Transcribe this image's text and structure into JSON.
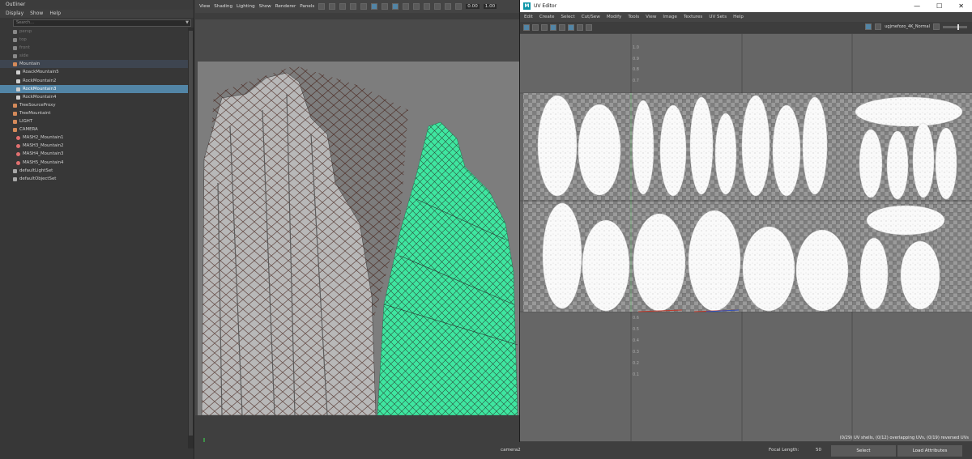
{
  "outliner": {
    "title": "Outliner",
    "menu": [
      "Display",
      "Show",
      "Help"
    ],
    "search_placeholder": "Search...",
    "items": [
      {
        "label": "persp",
        "indent": 0,
        "icon": "camera-icon",
        "state": "dim"
      },
      {
        "label": "top",
        "indent": 0,
        "icon": "camera-icon",
        "state": "dim"
      },
      {
        "label": "front",
        "indent": 0,
        "icon": "camera-icon",
        "state": "dim"
      },
      {
        "label": "side",
        "indent": 0,
        "icon": "camera-icon",
        "state": "dim"
      },
      {
        "label": "Mountain",
        "indent": 0,
        "icon": "group-icon",
        "state": "group"
      },
      {
        "label": "RoackMountain5",
        "indent": 1,
        "icon": "mesh-icon",
        "state": ""
      },
      {
        "label": "RockMountain2",
        "indent": 1,
        "icon": "mesh-icon",
        "state": ""
      },
      {
        "label": "RockMountain3",
        "indent": 1,
        "icon": "mesh-icon",
        "state": "selected"
      },
      {
        "label": "RockMountain4",
        "indent": 1,
        "icon": "mesh-icon",
        "state": ""
      },
      {
        "label": "TreeSourceProxy",
        "indent": 0,
        "icon": "group-icon",
        "state": ""
      },
      {
        "label": "TreeMountaint",
        "indent": 0,
        "icon": "group-icon",
        "state": ""
      },
      {
        "label": "LIGHT",
        "indent": 0,
        "icon": "group-icon",
        "state": ""
      },
      {
        "label": "CAMERA",
        "indent": 0,
        "icon": "group-icon",
        "state": ""
      },
      {
        "label": "MASH2_Mountain1",
        "indent": 1,
        "icon": "mash-icon",
        "state": ""
      },
      {
        "label": "MASH3_Mountain2",
        "indent": 1,
        "icon": "mash-icon",
        "state": ""
      },
      {
        "label": "MASH4_Mountain3",
        "indent": 1,
        "icon": "mash-icon",
        "state": ""
      },
      {
        "label": "MASH5_Mountain4",
        "indent": 1,
        "icon": "mash-icon",
        "state": ""
      },
      {
        "label": "defaultLightSet",
        "indent": 0,
        "icon": "set-icon",
        "state": ""
      },
      {
        "label": "defaultObjectSet",
        "indent": 0,
        "icon": "set-icon",
        "state": ""
      }
    ]
  },
  "viewport": {
    "menu": [
      "View",
      "Shading",
      "Lighting",
      "Show",
      "Renderer",
      "Panels"
    ],
    "field_a": "0.00",
    "field_b": "1.00",
    "camera_label": "camera2",
    "focal_length_label": "Focal Length:",
    "focal_length_value": "50"
  },
  "uv_editor": {
    "title": "UV Editor",
    "menu": [
      "Edit",
      "Create",
      "Select",
      "Cut/Sew",
      "Modify",
      "Tools",
      "View",
      "Image",
      "Textures",
      "UV Sets",
      "Help"
    ],
    "image_name": "ugjmefozo_4K_Normal",
    "grid_labels": [
      "1.0",
      "0.9",
      "0.8",
      "0.7",
      "0.6",
      "0.5",
      "0.4",
      "0.3",
      "0.2",
      "0.1"
    ],
    "status": "(0/29) UV shells, (0/12) overlapping UVs, (0/19) reversed UVs",
    "window_buttons": [
      "—",
      "☐",
      "✕"
    ]
  },
  "bottom": {
    "select_button": "Select",
    "load_attributes_button": "Load Attributes"
  },
  "colors": {
    "selection": "#5285a6",
    "highlight_mesh": "#3ee6a0",
    "wire": "#4a2a22",
    "maya_teal": "#0c95a8"
  }
}
